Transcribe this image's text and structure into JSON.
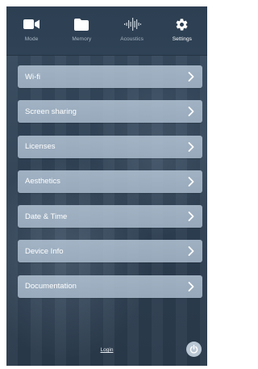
{
  "nav": {
    "tabs": [
      {
        "label": "Mode",
        "icon": "camera-icon",
        "active": false
      },
      {
        "label": "Memory",
        "icon": "folder-icon",
        "active": false
      },
      {
        "label": "Acoustics",
        "icon": "waveform-icon",
        "active": false
      },
      {
        "label": "Settings",
        "icon": "gear-icon",
        "active": true
      }
    ]
  },
  "menu": {
    "items": [
      {
        "label": "Wi-fi"
      },
      {
        "label": "Screen sharing"
      },
      {
        "label": "Licenses"
      },
      {
        "label": "Aesthetics"
      },
      {
        "label": "Date & Time"
      },
      {
        "label": "Device Info"
      },
      {
        "label": "Documentation"
      }
    ]
  },
  "footer": {
    "login_label": "Login",
    "power_icon": "power-icon"
  },
  "colors": {
    "background": "#2f4154",
    "nav_background": "#2d3f52",
    "menu_item": "#aabdd0",
    "inactive_label": "#aab6c3",
    "active_label": "#ffffff"
  }
}
